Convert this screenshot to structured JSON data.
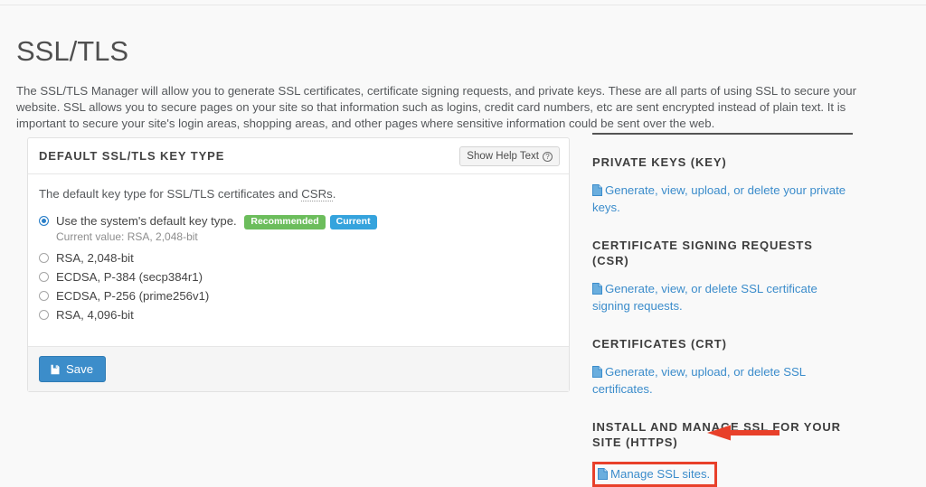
{
  "page": {
    "title": "SSL/TLS",
    "intro": "The SSL/TLS Manager will allow you to generate SSL certificates, certificate signing requests, and private keys. These are all parts of using SSL to secure your website. SSL allows you to secure pages on your site so that information such as logins, credit card numbers, etc are sent encrypted instead of plain text. It is important to secure your site's login areas, shopping areas, and other pages where sensitive information could be sent over the web."
  },
  "card": {
    "header_title": "DEFAULT SSL/TLS KEY TYPE",
    "help_button_label": "Show Help Text",
    "help_icon": "question-circle-icon",
    "lead_text_before": "The default key type for SSL/TLS certificates and ",
    "lead_abbr": "CSRs",
    "lead_text_after": ".",
    "default_option": {
      "label": "Use the system's default key type.",
      "badges": [
        {
          "label": "Recommended",
          "color": "#6cbd5c"
        },
        {
          "label": "Current",
          "color": "#35a3dd"
        }
      ],
      "current_value": "Current value: RSA, 2,048-bit",
      "selected": true
    },
    "options": [
      {
        "label": "RSA, 2,048-bit",
        "selected": false
      },
      {
        "label": "ECDSA, P-384 (secp384r1)",
        "selected": false
      },
      {
        "label": "ECDSA, P-256 (prime256v1)",
        "selected": false
      },
      {
        "label": "RSA, 4,096-bit",
        "selected": false
      }
    ],
    "save_label": "Save",
    "save_icon": "floppy-disk-icon"
  },
  "sidebar": {
    "sections": [
      {
        "heading": "PRIVATE KEYS (KEY)",
        "link": "Generate, view, upload, or delete your private keys.",
        "icon": "document-icon",
        "highlighted": false
      },
      {
        "heading": "CERTIFICATE SIGNING REQUESTS (CSR)",
        "link": "Generate, view, or delete SSL certificate signing requests.",
        "icon": "document-icon",
        "highlighted": false
      },
      {
        "heading": "CERTIFICATES (CRT)",
        "link": "Generate, view, upload, or delete SSL certificates.",
        "icon": "document-icon",
        "highlighted": false
      },
      {
        "heading": "INSTALL AND MANAGE SSL FOR YOUR SITE (HTTPS)",
        "link": "Manage SSL sites.",
        "icon": "document-icon",
        "highlighted": true
      }
    ]
  },
  "annotation": {
    "arrow_color": "#e8402a",
    "box_color": "#e8402a",
    "direction": "left"
  },
  "colors": {
    "link": "#3b8ccb",
    "primary_button": "#3c8dca",
    "page_background": "#f9f9f9"
  }
}
